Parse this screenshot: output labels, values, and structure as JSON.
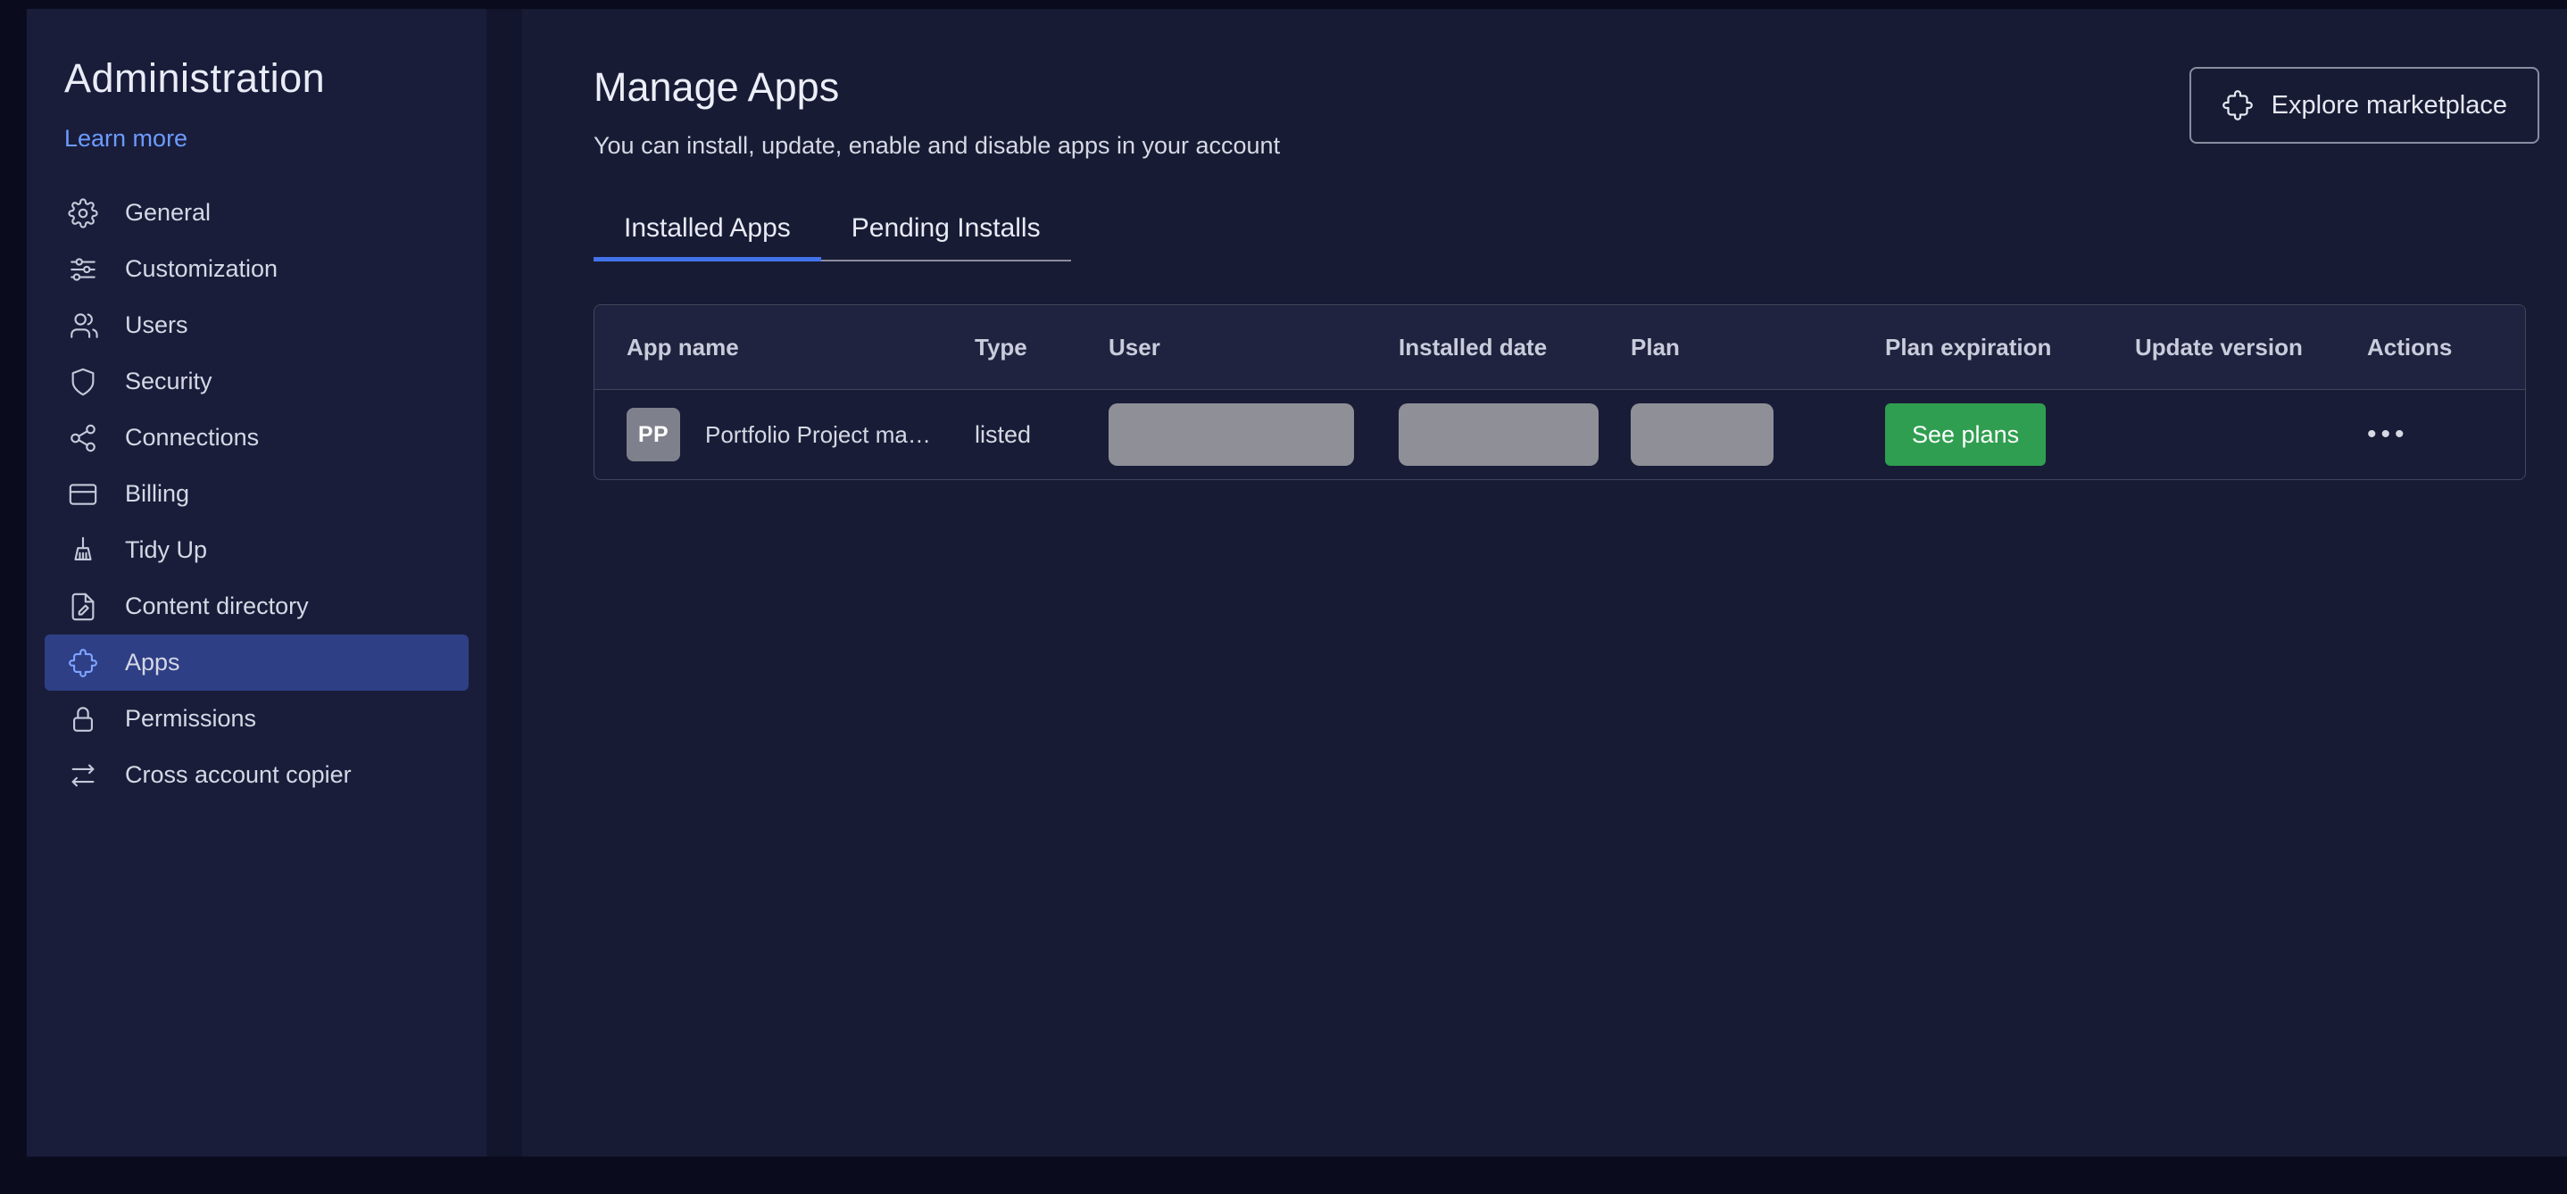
{
  "sidebar": {
    "title": "Administration",
    "learn_more_label": "Learn more",
    "items": [
      {
        "label": "General",
        "icon": "gear-icon",
        "selected": false
      },
      {
        "label": "Customization",
        "icon": "sliders-icon",
        "selected": false
      },
      {
        "label": "Users",
        "icon": "users-icon",
        "selected": false
      },
      {
        "label": "Security",
        "icon": "shield-icon",
        "selected": false
      },
      {
        "label": "Connections",
        "icon": "nodes-icon",
        "selected": false
      },
      {
        "label": "Billing",
        "icon": "credit-card-icon",
        "selected": false
      },
      {
        "label": "Tidy Up",
        "icon": "broom-icon",
        "selected": false
      },
      {
        "label": "Content directory",
        "icon": "document-edit-icon",
        "selected": false
      },
      {
        "label": "Apps",
        "icon": "puzzle-icon",
        "selected": true
      },
      {
        "label": "Permissions",
        "icon": "lock-icon",
        "selected": false
      },
      {
        "label": "Cross account copier",
        "icon": "transfer-arrows-icon",
        "selected": false
      }
    ]
  },
  "header": {
    "title": "Manage Apps",
    "subtitle": "You can install, update, enable and disable apps in your account",
    "explore_button_label": "Explore marketplace",
    "explore_button_icon": "puzzle-icon"
  },
  "tabs": [
    {
      "label": "Installed Apps",
      "active": true
    },
    {
      "label": "Pending Installs",
      "active": false
    }
  ],
  "table": {
    "columns": [
      "App name",
      "Type",
      "User",
      "Installed date",
      "Plan",
      "Plan expiration",
      "Update version",
      "Actions"
    ],
    "rows": [
      {
        "app_initials": "PP",
        "app_name": "Portfolio Project ma…",
        "type": "listed",
        "user_redacted": true,
        "installed_date_redacted": true,
        "plan_redacted": true,
        "plan_expiration_button": "See plans",
        "update_version": "",
        "actions_menu": "•••"
      }
    ]
  },
  "colors": {
    "link_blue": "#6d9bff",
    "tab_underline_blue": "#4273ea",
    "selected_item_bg": "#2e3f86",
    "see_plans_green": "#2f9e50",
    "redacted_gray": "#8f9097",
    "sidebar_bg": "#191d3a",
    "main_bg": "#181b34"
  }
}
